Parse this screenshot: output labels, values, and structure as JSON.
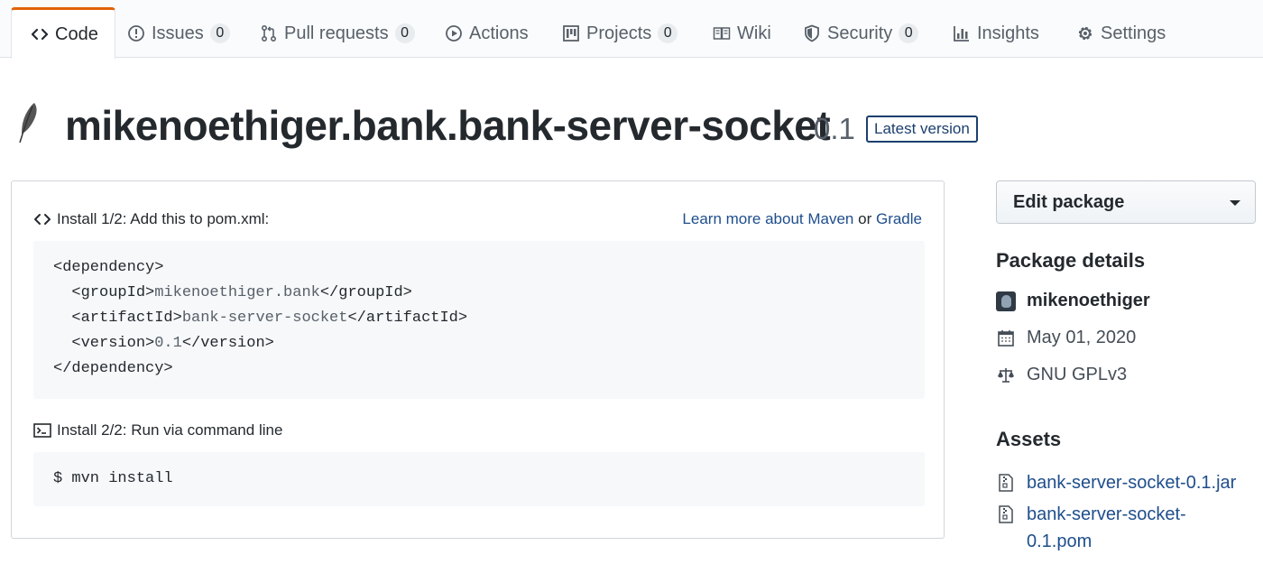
{
  "tabs": [
    {
      "label": "Code",
      "icon": "code-icon",
      "selected": true
    },
    {
      "label": "Issues",
      "icon": "issue-icon",
      "count": "0"
    },
    {
      "label": "Pull requests",
      "icon": "pull-request-icon",
      "count": "0"
    },
    {
      "label": "Actions",
      "icon": "play-icon"
    },
    {
      "label": "Projects",
      "icon": "project-icon",
      "count": "0"
    },
    {
      "label": "Wiki",
      "icon": "book-icon"
    },
    {
      "label": "Security",
      "icon": "shield-icon",
      "count": "0"
    },
    {
      "label": "Insights",
      "icon": "graph-icon"
    },
    {
      "label": "Settings",
      "icon": "gear-icon"
    }
  ],
  "package": {
    "icon": "feather-icon",
    "name": "mikenoethiger.bank.bank-server-socket",
    "version": "0.1",
    "badge": "Latest version"
  },
  "install": {
    "step1": {
      "label": "Install 1/2: Add this to pom.xml:",
      "learn_prefix": "Learn more about Maven",
      "learn_or": "or",
      "learn_gradle": "Gradle",
      "code": {
        "open_dependency": "<dependency>",
        "group_open": "  <groupId>",
        "group_value": "mikenoethiger.bank",
        "group_close": "</groupId>",
        "artifact_open": "  <artifactId>",
        "artifact_value": "bank-server-socket",
        "artifact_close": "</artifactId>",
        "version_open": "  <version>",
        "version_value": "0.1",
        "version_close": "</version>",
        "close_dependency": "</dependency>"
      }
    },
    "step2": {
      "label": "Install 2/2: Run via command line",
      "command": "$ mvn install"
    }
  },
  "sidebar": {
    "edit_button": "Edit package",
    "details_heading": "Package details",
    "owner": "mikenoethiger",
    "date": "May 01, 2020",
    "license": "GNU GPLv3",
    "assets_heading": "Assets",
    "assets": [
      "bank-server-socket-0.1.jar",
      "bank-server-socket-",
      "0.1.pom"
    ]
  },
  "colors": {
    "accent_tab": "#e36209",
    "link": "#1f4e8c",
    "badge": "#1c3f6e"
  }
}
